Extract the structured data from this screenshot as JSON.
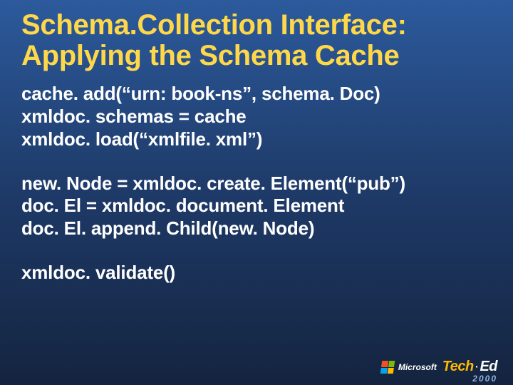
{
  "title": "Schema.Collection Interface: Applying the Schema Cache",
  "code": {
    "block1": [
      "cache. add(“urn: book-ns”, schema. Doc)",
      "xmldoc. schemas = cache",
      "xmldoc. load(“xmlfile. xml”)"
    ],
    "block2": [
      "new. Node = xmldoc. create. Element(“pub”)",
      "doc. El = xmldoc. document. Element",
      "doc. El. append. Child(new. Node)"
    ],
    "block3": [
      "xmldoc. validate()"
    ]
  },
  "branding": {
    "company": "Microsoft",
    "event_part1": "Tech",
    "event_part2": "Ed",
    "year": "2000"
  }
}
